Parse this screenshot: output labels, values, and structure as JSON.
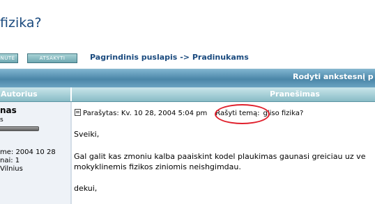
{
  "topic": {
    "title": "fizika?"
  },
  "buttons": {
    "new_topic": "NUTĖ",
    "reply": "ATSAKYTI"
  },
  "breadcrumb": {
    "home": "Pagrindinis puslapis",
    "separator": "->",
    "forum": "Pradinukams"
  },
  "topbar": {
    "prev_topic": "Rodyti ankstesnį p"
  },
  "table_headers": {
    "author": "Autorius",
    "message": "Pranešimas"
  },
  "author": {
    "name": "nas",
    "rank": "s",
    "joined": "me: 2004 10 28",
    "posts": "nai: 1",
    "location": "Vilnius"
  },
  "post": {
    "posted": "Parašytas: Kv. 10 28, 2004 5:04 pm",
    "subject_label": "Rašyti temą:",
    "subject": "gliso fizika?",
    "body": [
      "Sveiki,",
      "Gal galit kas zmoniu kalba paaiskint kodel plaukimas gaunasi greiciau uz ve",
      "mokyklinemis fizikos ziniomis neishgimdau.",
      "dekui,"
    ]
  },
  "colors": {
    "title": "#1a4a7e",
    "bar": "#4b86a8",
    "header_row": "#88bcc6",
    "annotation": "#e0202c"
  }
}
